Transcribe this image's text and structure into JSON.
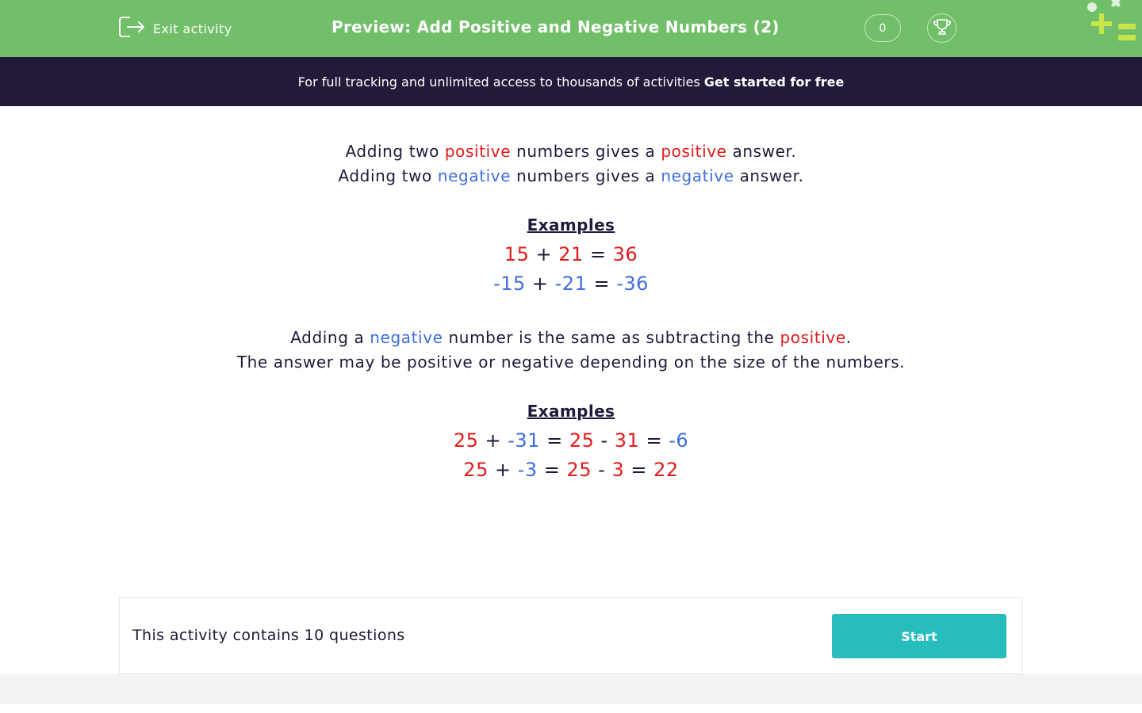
{
  "header": {
    "exit_label": "Exit activity",
    "title": "Preview: Add Positive and Negative Numbers (2)",
    "score": "0",
    "exit_icon": "exit-icon",
    "trophy_icon": "trophy-icon",
    "logo_icon": "plus-equals-logo"
  },
  "promo": {
    "text": "For full tracking and unlimited access to thousands of activities",
    "link": "Get started for free"
  },
  "content": {
    "rule1": [
      "Adding two ",
      "positive",
      " numbers gives a ",
      "positive",
      " answer."
    ],
    "rule2": [
      "Adding two ",
      "negative",
      " numbers gives a ",
      "negative",
      " answer."
    ],
    "examples_heading_1": "Examples",
    "ex1": [
      "15",
      " + ",
      "21",
      " = ",
      "36"
    ],
    "ex2": [
      "-15",
      " + ",
      "-21",
      " = ",
      "-36"
    ],
    "rule3": [
      "Adding a ",
      "negative",
      " number is the same as subtracting the ",
      "positive",
      "."
    ],
    "rule4": "The answer may be positive or negative depending on the size of the numbers.",
    "examples_heading_2": "Examples",
    "ex3": [
      "25",
      " + ",
      "-31",
      " = ",
      "25",
      " - ",
      "31",
      " = ",
      "-6"
    ],
    "ex4": [
      "25",
      " + ",
      "-3",
      " = ",
      "25",
      " - ",
      "3",
      " = ",
      "22"
    ]
  },
  "footer": {
    "count_text": "This activity contains 10 questions",
    "start_label": "Start"
  },
  "colors": {
    "header_green": "#72bf6a",
    "promo_dark": "#231a3a",
    "positive_red": "#e31b1b",
    "negative_blue": "#3f6ee0",
    "start_teal": "#26bdbc"
  }
}
